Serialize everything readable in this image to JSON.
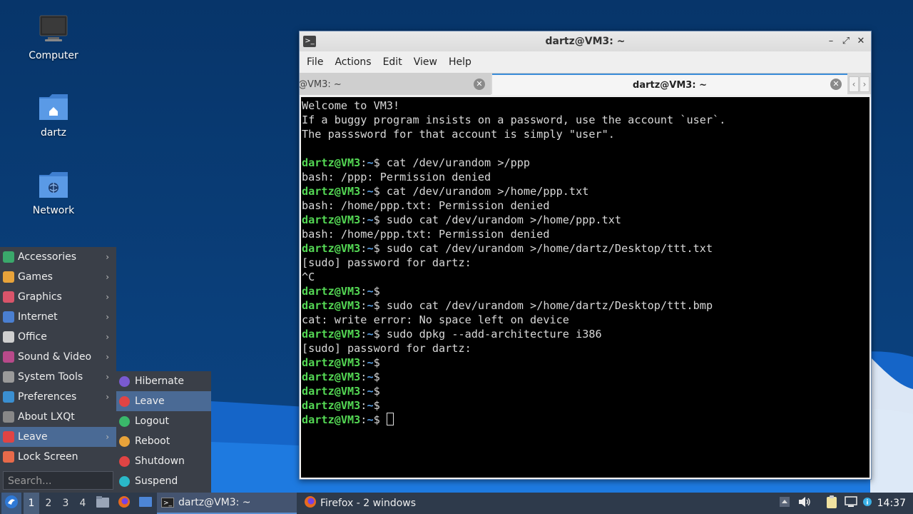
{
  "desktop": {
    "icons": [
      {
        "label": "Computer",
        "icon": "computer-icon"
      },
      {
        "label": "dartz",
        "icon": "home-folder-icon"
      },
      {
        "label": "Network",
        "icon": "network-folder-icon"
      }
    ]
  },
  "terminal": {
    "title": "dartz@VM3: ~",
    "menu": [
      "File",
      "Actions",
      "Edit",
      "View",
      "Help"
    ],
    "tabs": [
      {
        "label": "@VM3: ~"
      },
      {
        "label": "dartz@VM3: ~"
      }
    ],
    "lines": [
      {
        "text": "Welcome to VM3!"
      },
      {
        "text": "If a buggy program insists on a password, use the account `user`."
      },
      {
        "text": "The passsword for that account is simply \"user\"."
      },
      {
        "text": ""
      },
      {
        "prompt": true,
        "cmd": "cat /dev/urandom >/ppp"
      },
      {
        "text": "bash: /ppp: Permission denied"
      },
      {
        "prompt": true,
        "cmd": "cat /dev/urandom >/home/ppp.txt"
      },
      {
        "text": "bash: /home/ppp.txt: Permission denied"
      },
      {
        "prompt": true,
        "cmd": "sudo cat /dev/urandom >/home/ppp.txt"
      },
      {
        "text": "bash: /home/ppp.txt: Permission denied"
      },
      {
        "prompt": true,
        "cmd": "sudo cat /dev/urandom >/home/dartz/Desktop/ttt.txt"
      },
      {
        "text": "[sudo] password for dartz:"
      },
      {
        "text": "^C"
      },
      {
        "prompt": true,
        "cmd": ""
      },
      {
        "prompt": true,
        "cmd": "sudo cat /dev/urandom >/home/dartz/Desktop/ttt.bmp"
      },
      {
        "text": "cat: write error: No space left on device"
      },
      {
        "prompt": true,
        "cmd": "sudo dpkg --add-architecture i386"
      },
      {
        "text": "[sudo] password for dartz:"
      },
      {
        "prompt": true,
        "cmd": ""
      },
      {
        "prompt": true,
        "cmd": ""
      },
      {
        "prompt": true,
        "cmd": ""
      },
      {
        "prompt": true,
        "cmd": ""
      },
      {
        "prompt": true,
        "cmd": "",
        "cursor": true
      }
    ],
    "prompt_user": "dartz@VM3",
    "prompt_sep": ":",
    "prompt_path": "~",
    "prompt_end": "$ "
  },
  "app_menu": {
    "items": [
      {
        "label": "Accessories",
        "icon": "accessories-icon",
        "color": "#3aa86b",
        "submenu": true
      },
      {
        "label": "Games",
        "icon": "games-icon",
        "color": "#e8a33a",
        "submenu": true
      },
      {
        "label": "Graphics",
        "icon": "graphics-icon",
        "color": "#d9546a",
        "submenu": true
      },
      {
        "label": "Internet",
        "icon": "internet-icon",
        "color": "#4a7fd1",
        "submenu": true
      },
      {
        "label": "Office",
        "icon": "office-icon",
        "color": "#cfcfcf",
        "submenu": true
      },
      {
        "label": "Sound & Video",
        "icon": "sound-video-icon",
        "color": "#b84a8a",
        "submenu": true
      },
      {
        "label": "System Tools",
        "icon": "system-tools-icon",
        "color": "#9a9a9a",
        "submenu": true
      },
      {
        "label": "Preferences",
        "icon": "preferences-icon",
        "color": "#3a8fd1",
        "submenu": true
      },
      {
        "label": "About LXQt",
        "icon": "about-icon",
        "color": "#888888",
        "submenu": false
      },
      {
        "label": "Leave",
        "icon": "leave-icon",
        "color": "#e04444",
        "submenu": true,
        "active": true
      },
      {
        "label": "Lock Screen",
        "icon": "lock-icon",
        "color": "#e86a4a",
        "submenu": false
      }
    ],
    "search_placeholder": "Search..."
  },
  "leave_menu": {
    "items": [
      {
        "label": "Hibernate",
        "icon": "hibernate-icon",
        "color": "#7a5ad1"
      },
      {
        "label": "Leave",
        "icon": "leave-icon",
        "color": "#e04444",
        "active": true
      },
      {
        "label": "Logout",
        "icon": "logout-icon",
        "color": "#3ab86a"
      },
      {
        "label": "Reboot",
        "icon": "reboot-icon",
        "color": "#e8a33a"
      },
      {
        "label": "Shutdown",
        "icon": "shutdown-icon",
        "color": "#e04444"
      },
      {
        "label": "Suspend",
        "icon": "suspend-icon",
        "color": "#2ab8c8"
      }
    ]
  },
  "taskbar": {
    "workspaces": [
      "1",
      "2",
      "3",
      "4"
    ],
    "active_workspace": "1",
    "tasks": [
      {
        "label": "dartz@VM3: ~",
        "icon": "terminal-icon",
        "active": true
      },
      {
        "label": "Firefox - 2 windows",
        "icon": "firefox-icon",
        "active": false
      }
    ],
    "clock": "14:37"
  }
}
